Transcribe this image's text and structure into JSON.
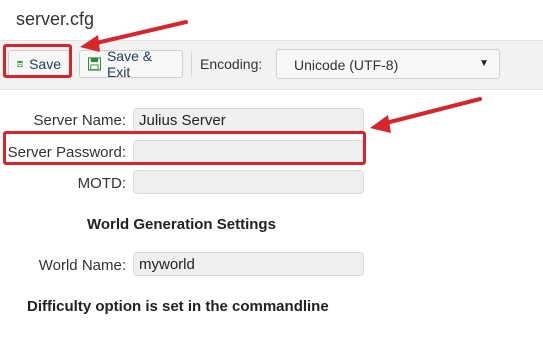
{
  "window": {
    "title": "server.cfg"
  },
  "toolbar": {
    "save_label": "Save",
    "save_exit_label": "Save & Exit",
    "encoding_label": "Encoding:",
    "encoding_value": "Unicode (UTF-8)"
  },
  "form": {
    "server_name_label": "Server Name:",
    "server_name_value": "Julius Server",
    "server_password_label": "Server Password:",
    "server_password_value": "",
    "motd_label": "MOTD:",
    "motd_value": "",
    "world_section_title": "World Generation Settings",
    "world_name_label": "World Name:",
    "world_name_value": "myworld",
    "difficulty_note": "Difficulty option is set in the commandline"
  },
  "colors": {
    "annotation_red": "#d9242b",
    "save_icon_green": "#2e8b3a"
  },
  "icons": [
    "floppy-save-icon",
    "floppy-save-exit-icon",
    "dropdown-arrow-icon"
  ]
}
